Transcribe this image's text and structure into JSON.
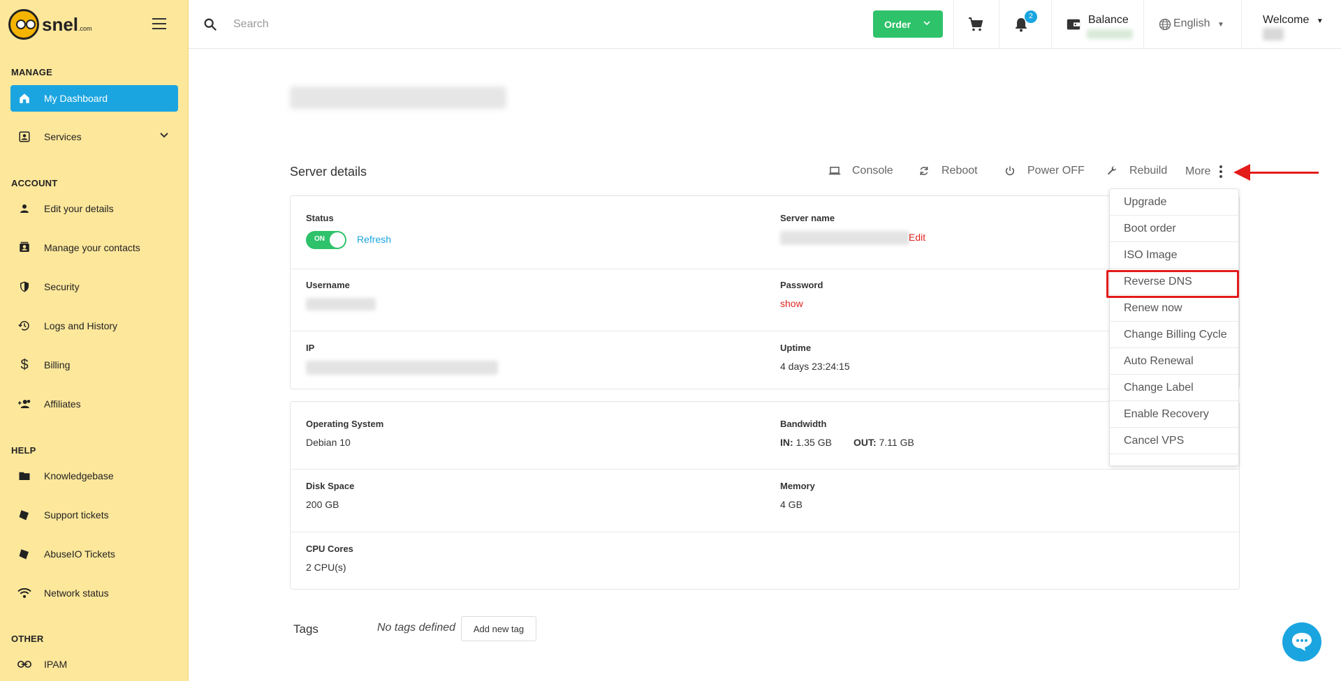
{
  "sidebar": {
    "logo_text": "snel",
    "logo_suffix": ".com",
    "sections": {
      "manage": "MANAGE",
      "account": "ACCOUNT",
      "help": "HELP",
      "other": "OTHER"
    },
    "items": {
      "dashboard": "My Dashboard",
      "services": "Services",
      "edit_details": "Edit your details",
      "contacts": "Manage your contacts",
      "security": "Security",
      "logs": "Logs and History",
      "billing": "Billing",
      "affiliates": "Affiliates",
      "knowledgebase": "Knowledgebase",
      "support": "Support tickets",
      "abuseio": "AbuseIO Tickets",
      "network": "Network status",
      "ipam": "IPAM"
    }
  },
  "topbar": {
    "search_placeholder": "Search",
    "order_label": "Order",
    "notification_count": "2",
    "balance_label": "Balance",
    "language": "English",
    "welcome": "Welcome"
  },
  "server": {
    "section_title": "Server details",
    "actions": {
      "console": "Console",
      "reboot": "Reboot",
      "power_off": "Power OFF",
      "rebuild": "Rebuild",
      "more": "More"
    },
    "status_label": "Status",
    "toggle_text": "ON",
    "refresh_label": "Refresh",
    "server_name_label": "Server name",
    "edit_label": "Edit",
    "username_label": "Username",
    "password_label": "Password",
    "password_show": "show",
    "ip_label": "IP",
    "uptime_label": "Uptime",
    "uptime_value": "4 days 23:24:15",
    "os_label": "Operating System",
    "os_value": "Debian 10",
    "bandwidth_label": "Bandwidth",
    "bw_in_label": "IN:",
    "bw_in_value": "1.35 GB",
    "bw_out_label": "OUT:",
    "bw_out_value": "7.11 GB",
    "disk_label": "Disk Space",
    "disk_value": "200 GB",
    "memory_label": "Memory",
    "memory_value": "4 GB",
    "cpu_label": "CPU Cores",
    "cpu_value": "2 CPU(s)"
  },
  "tags": {
    "label": "Tags",
    "empty": "No tags defined",
    "add_button": "Add new tag"
  },
  "more_menu": [
    "Upgrade",
    "Boot order",
    "ISO Image",
    "Reverse DNS",
    "Renew now",
    "Change Billing Cycle",
    "Auto Renewal",
    "Change Label",
    "Enable Recovery",
    "Cancel VPS"
  ],
  "colors": {
    "sidebar_bg": "#fde79b",
    "accent_blue": "#1ba5e0",
    "order_green": "#2ec26a",
    "annotation_red": "#e41b1b"
  }
}
